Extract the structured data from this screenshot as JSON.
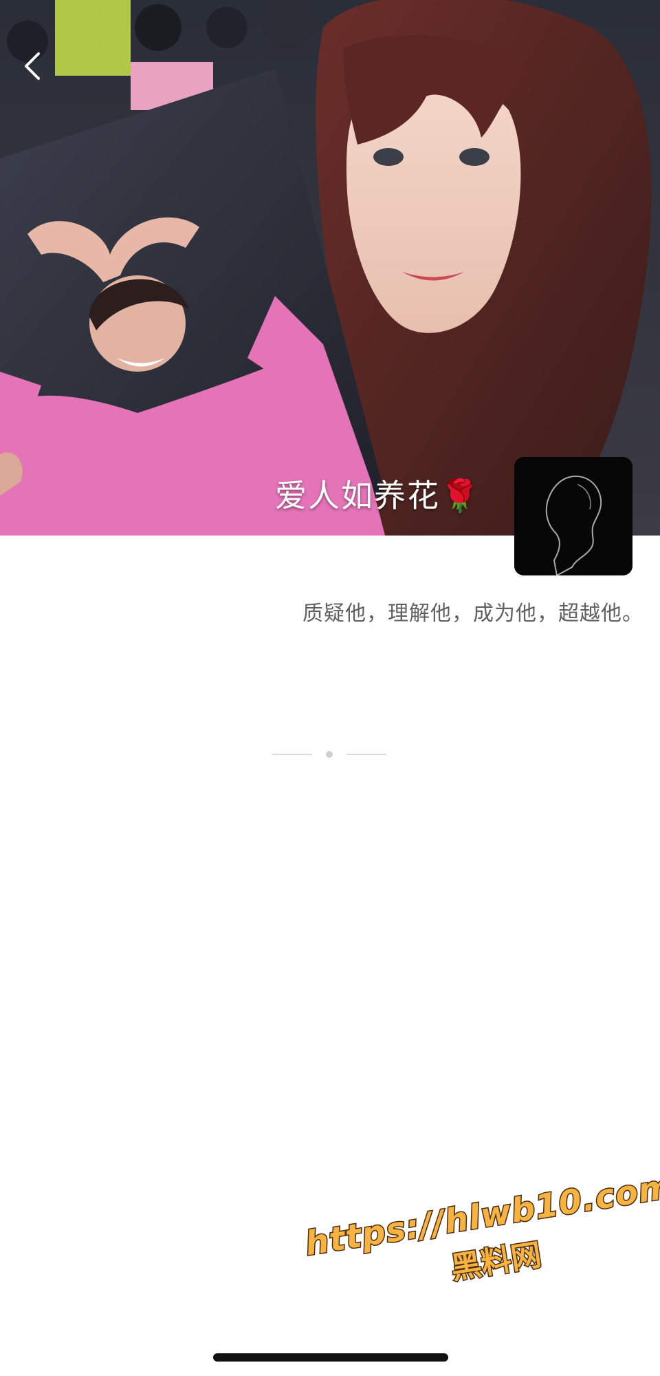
{
  "cover": {
    "caption": "爱人如养花",
    "caption_emoji": "🌹"
  },
  "header": {
    "back_icon": "chevron-left-icon"
  },
  "profile": {
    "avatar_icon": "silhouette-portrait-icon",
    "signature": "质疑他，理解他，成为他，超越他。"
  },
  "feed": {
    "end_marker_icon": "end-of-feed-divider-icon"
  },
  "watermark": {
    "url": "https://hlwb10.com",
    "site_name": "黑料网"
  },
  "system": {
    "home_indicator_icon": "home-indicator-bar-icon"
  },
  "colors": {
    "signature_text": "#606060",
    "watermark_fill": "#f6b33f",
    "watermark_stroke": "#4a2a10",
    "page_background": "#ffffff"
  }
}
